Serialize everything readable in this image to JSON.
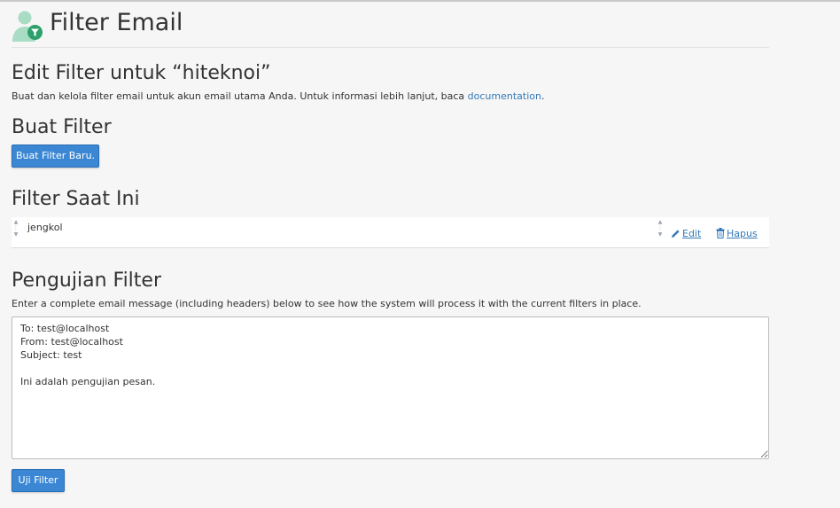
{
  "header": {
    "title": "Filter Email",
    "icon": "user-filter-icon"
  },
  "edit_section": {
    "heading": "Edit Filter untuk “hiteknoi”",
    "description_prefix": "Buat dan kelola filter email untuk akun email utama Anda. Untuk informasi lebih lanjut, baca ",
    "documentation_link": "documentation",
    "description_suffix": "."
  },
  "create_section": {
    "heading": "Buat Filter",
    "button_label": "Buat Filter Baru."
  },
  "current_section": {
    "heading": "Filter Saat Ini",
    "filters": [
      {
        "name": "jengkol",
        "edit_label": "Edit",
        "delete_label": "Hapus"
      }
    ]
  },
  "test_section": {
    "heading": "Pengujian Filter",
    "description": "Enter a complete email message (including headers) below to see how the system will process it with the current filters in place.",
    "message": "To: test@localhost\nFrom: test@localhost\nSubject: test\n\nIni adalah pengujian pesan.",
    "button_label": "Uji Filter"
  },
  "colors": {
    "accent": "#3b87d4",
    "link": "#337ab7",
    "icon_green": "#2ea06b"
  }
}
